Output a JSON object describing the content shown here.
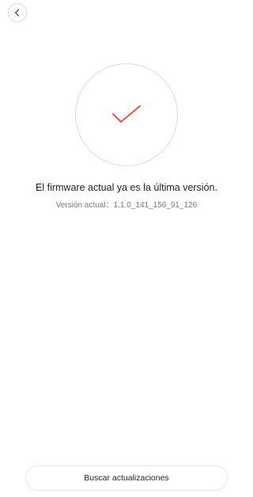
{
  "navigation": {
    "back_icon": "chevron-left-icon"
  },
  "status": {
    "icon": "checkmark-icon",
    "accent_color": "#e8524a",
    "title": "El firmware actual ya es la última versión.",
    "version_label": "Versión actual：",
    "version_value": "1.1.0_141_156_91_126"
  },
  "actions": {
    "check_updates_label": "Buscar actualizaciones"
  }
}
